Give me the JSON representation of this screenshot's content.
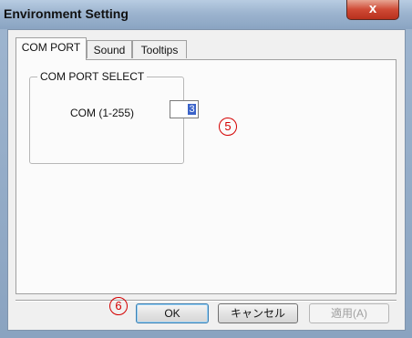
{
  "window": {
    "title": "Environment Setting",
    "close_label": "x"
  },
  "tabs": [
    {
      "label": "COM PORT",
      "active": true
    },
    {
      "label": "Sound",
      "active": false
    },
    {
      "label": "Tooltips",
      "active": false
    }
  ],
  "com_port_select": {
    "group_title": "COM PORT SELECT",
    "field_label": "COM (1-255)",
    "value": "3"
  },
  "annotations": {
    "five": "5",
    "six": "6"
  },
  "buttons": {
    "ok": "OK",
    "cancel": "キャンセル",
    "apply": "適用(A)"
  },
  "colors": {
    "annotation": "#d40000",
    "close_button": "#cf4a35",
    "selection": "#3b63c9"
  }
}
